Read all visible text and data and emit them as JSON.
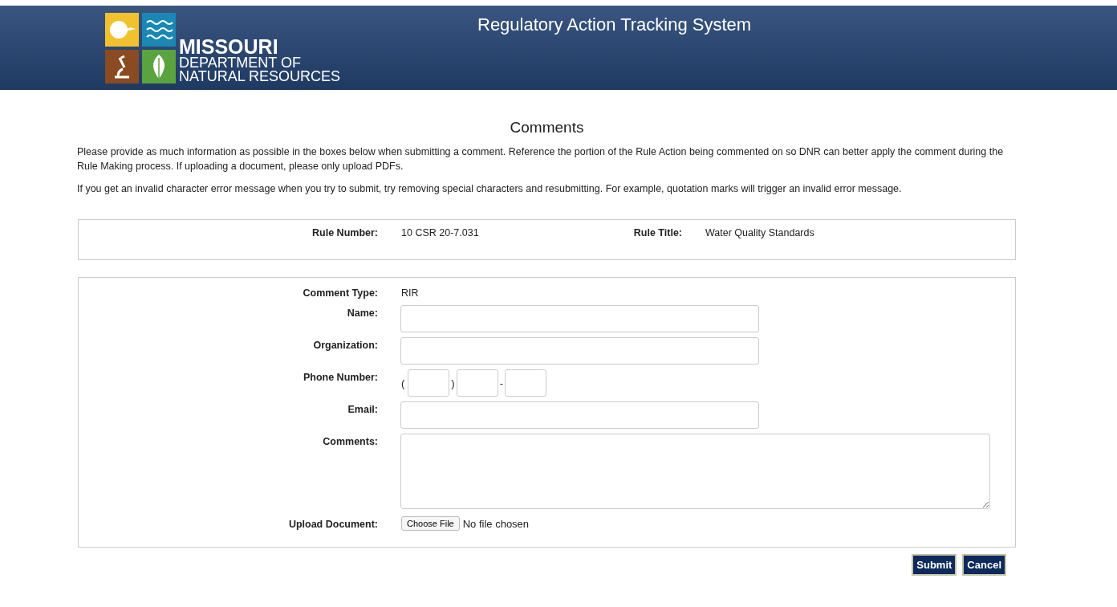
{
  "header": {
    "logo": {
      "line1": "MISSOURI",
      "line2": "DEPARTMENT OF",
      "line3": "NATURAL RESOURCES"
    },
    "title": "Regulatory Action Tracking System"
  },
  "page_title": "Comments",
  "intro": [
    "Please provide as much information as possible in the boxes below when submitting a comment. Reference the portion of the Rule Action being commented on so DNR can better apply the comment during the Rule Making process. If uploading a document, please only upload PDFs.",
    "If you get an invalid character error message when you try to submit, try removing special characters and resubmitting. For example, quotation marks will trigger an invalid error message."
  ],
  "rule": {
    "number_label": "Rule Number:",
    "number": "10 CSR 20-7.031",
    "title_label": "Rule Title:",
    "title": "Water Quality Standards"
  },
  "form": [
    {
      "kind": "static",
      "label": "Comment Type:",
      "value": "RIR"
    },
    {
      "kind": "text",
      "label": "Name:"
    },
    {
      "kind": "text",
      "label": "Organization:"
    },
    {
      "kind": "phone",
      "label": "Phone Number:",
      "open": "(",
      "close": ")",
      "dash": "-"
    },
    {
      "kind": "text",
      "label": "Email:"
    },
    {
      "kind": "textarea",
      "label": "Comments:"
    },
    {
      "kind": "file",
      "label": "Upload Document:",
      "button": "Choose File",
      "status": "No file chosen"
    }
  ],
  "buttons": [
    "Submit",
    "Cancel"
  ]
}
